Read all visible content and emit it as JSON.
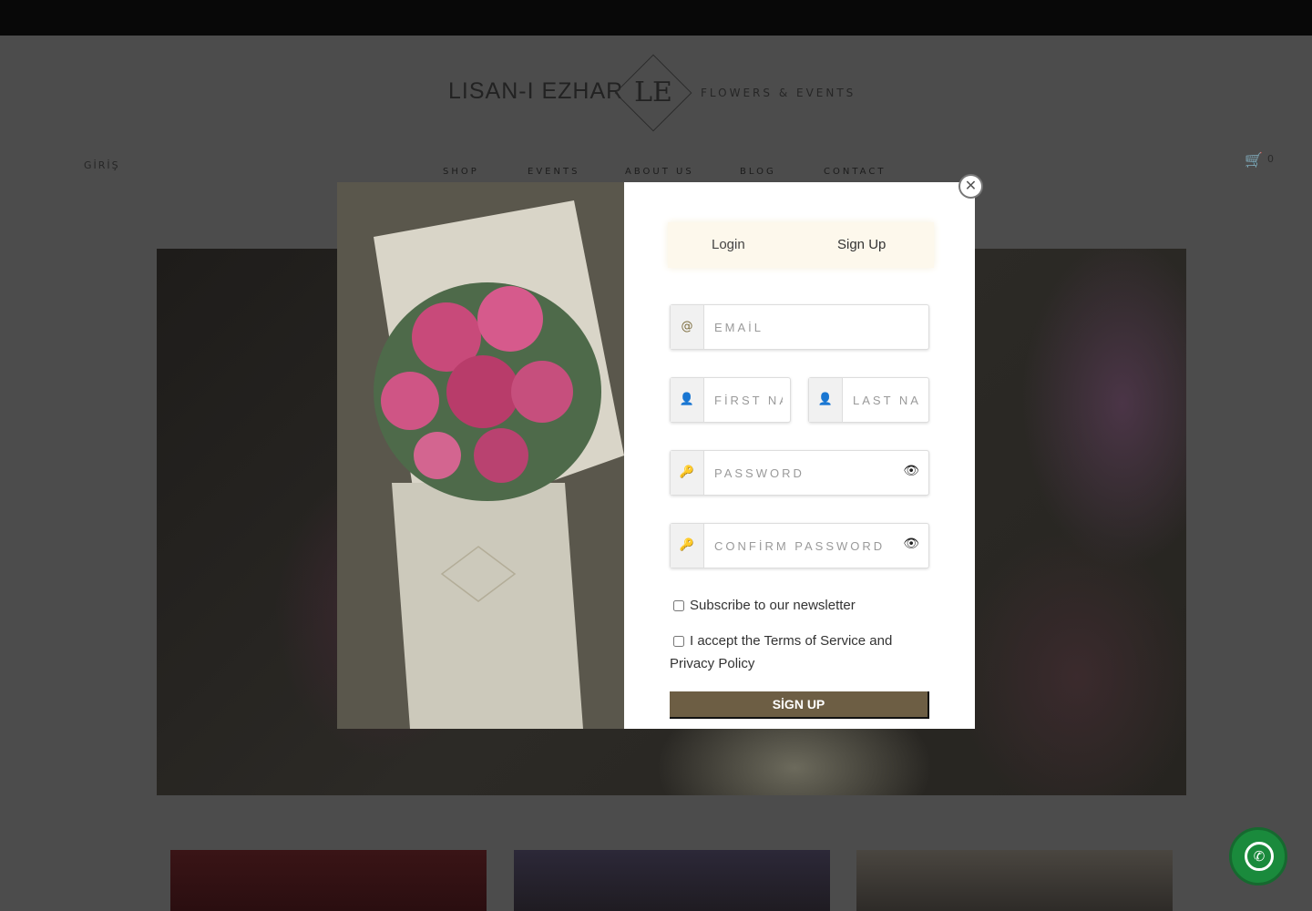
{
  "header": {
    "logo_left": "LISAN-I EZHAR",
    "logo_monogram": "LE",
    "logo_right": "FLOWERS & EVENTS",
    "login_link": "GİRİŞ",
    "cart_count": "0",
    "nav": [
      "SHOP",
      "EVENTS",
      "ABOUT US",
      "BLOG",
      "CONTACT"
    ]
  },
  "modal": {
    "tabs": {
      "login": "Login",
      "signup": "Sign Up"
    },
    "email_placeholder": "EMAİL",
    "first_name_placeholder": "FİRST NAME",
    "last_name_placeholder": "LAST NAME",
    "password_placeholder": "PASSWORD",
    "confirm_password_placeholder": "CONFİRM PASSWORD",
    "newsletter_label": "Subscribe to our newsletter",
    "terms_label": "I accept the Terms of Service and Privacy Policy",
    "signup_button": "SİGN UP",
    "close_icon": "close-circle-icon"
  },
  "colors": {
    "button": "#6d5e44",
    "tabs_bg": "#fdf8ec",
    "whatsapp": "#1a8a3c"
  }
}
